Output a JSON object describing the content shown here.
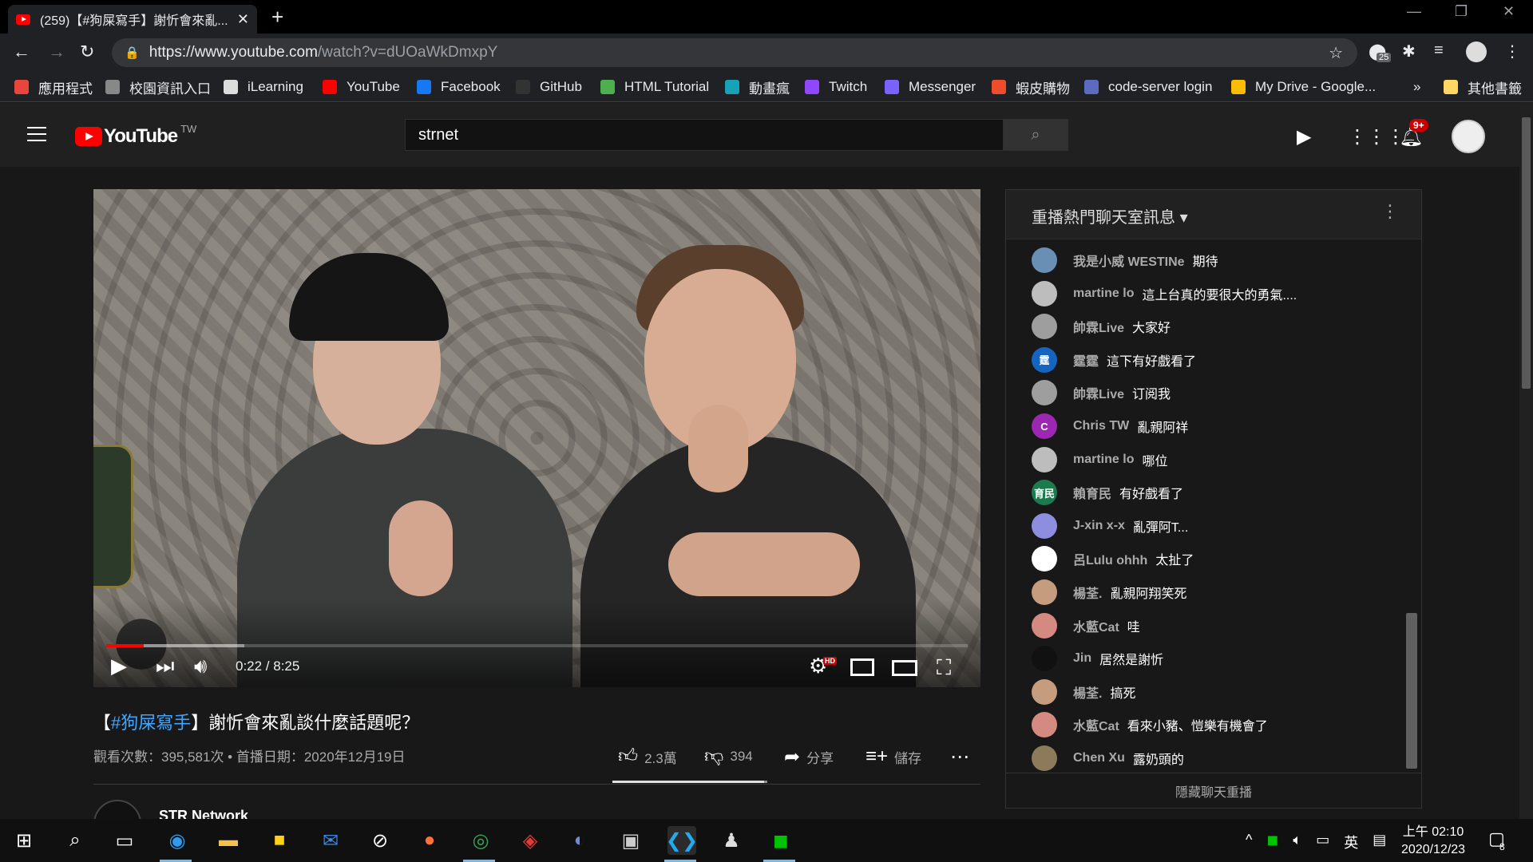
{
  "browser": {
    "tab_title": "(259)【#狗屎寫手】謝忻會來亂...",
    "url_host": "https://www.youtube.com",
    "url_path": "/watch?v=dUOaWkDmxpY",
    "extension_badge": "25",
    "bookmarks": [
      {
        "label": "應用程式",
        "color": "#e8453c"
      },
      {
        "label": "校園資訊入口",
        "color": "#888888"
      },
      {
        "label": "iLearning",
        "color": "#dddddd"
      },
      {
        "label": "YouTube",
        "color": "#ff0000"
      },
      {
        "label": "Facebook",
        "color": "#1877f2"
      },
      {
        "label": "GitHub",
        "color": "#333333"
      },
      {
        "label": "HTML Tutorial",
        "color": "#4caf50"
      },
      {
        "label": "動畫瘋",
        "color": "#17a2b8"
      },
      {
        "label": "Twitch",
        "color": "#9146ff"
      },
      {
        "label": "Messenger",
        "color": "#7b61ff"
      },
      {
        "label": "蝦皮購物",
        "color": "#ee4d2d"
      },
      {
        "label": "code-server login",
        "color": "#5c6bc0"
      },
      {
        "label": "My Drive - Google...",
        "color": "#fbbc04"
      }
    ],
    "bookmarks_more": "»",
    "other_bookmarks": "其他書籤"
  },
  "youtube": {
    "logo_text": "YouTube",
    "region": "TW",
    "search_value": "strnet",
    "notification_badge": "9+"
  },
  "video": {
    "time": "0:22 / 8:25",
    "played_fraction": 0.044,
    "loaded_fraction": 0.16,
    "hd_badge": "HD",
    "title_prefix": "【",
    "title_tag": "#狗屎寫手",
    "title_rest": "】謝忻會來亂談什麼話題呢？",
    "meta": "觀看次數：395,581次 • 首播日期：2020年12月19日",
    "likes": "2.3萬",
    "dislikes": "394",
    "share_label": "分享",
    "save_label": "儲存",
    "like_fraction": 0.98,
    "channel_name": "STR Network"
  },
  "chat": {
    "title": "重播熱門聊天室訊息",
    "footer": "隱藏聊天重播",
    "messages": [
      {
        "author": "我是小威 WESTINe",
        "text": "期待",
        "avatar": "#6a8fb5",
        "initial": ""
      },
      {
        "author": "martine lo",
        "text": "這上台真的要很大的勇氣....",
        "avatar": "#bdbdbd",
        "initial": ""
      },
      {
        "author": "帥霖Live",
        "text": "大家好",
        "avatar": "#9e9e9e",
        "initial": ""
      },
      {
        "author": "霆霆",
        "text": "這下有好戲看了",
        "avatar": "#1565c0",
        "initial": "霆"
      },
      {
        "author": "帥霖Live",
        "text": "订阅我",
        "avatar": "#9e9e9e",
        "initial": ""
      },
      {
        "author": "Chris TW",
        "text": "亂親阿祥",
        "avatar": "#9c27b0",
        "initial": "C"
      },
      {
        "author": "martine lo",
        "text": "哪位",
        "avatar": "#bdbdbd",
        "initial": ""
      },
      {
        "author": "賴育民",
        "text": "有好戲看了",
        "avatar": "#1b7a4e",
        "initial": "育民"
      },
      {
        "author": "J-xin x-x",
        "text": "亂彈阿T...",
        "avatar": "#8e8ee0",
        "initial": ""
      },
      {
        "author": "呂Lulu ohhh",
        "text": "太扯了",
        "avatar": "#ffffff",
        "initial": ""
      },
      {
        "author": "楊荃.",
        "text": "亂親阿翔笑死",
        "avatar": "#c69c7e",
        "initial": ""
      },
      {
        "author": "水藍Cat",
        "text": "哇",
        "avatar": "#d48a80",
        "initial": ""
      },
      {
        "author": "Jin",
        "text": "居然是謝忻",
        "avatar": "#111111",
        "initial": ""
      },
      {
        "author": "楊荃.",
        "text": "搞死",
        "avatar": "#c69c7e",
        "initial": ""
      },
      {
        "author": "水藍Cat",
        "text": "看來小豬、愷樂有機會了",
        "avatar": "#d48a80",
        "initial": ""
      },
      {
        "author": "Chen Xu",
        "text": "露奶頭的",
        "avatar": "#8d7a5a",
        "initial": ""
      }
    ]
  },
  "taskbar": {
    "ime": "英",
    "time": "上午 02:10",
    "date": "2020/12/23",
    "notif_count": "8"
  }
}
